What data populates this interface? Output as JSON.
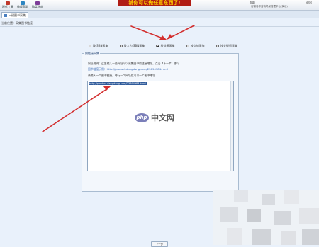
{
  "toolbar": {
    "buttons": [
      {
        "label": "建代工具",
        "color": "#c0392b"
      },
      {
        "label": "教程帮助",
        "color": "#2e86c1"
      },
      {
        "label": "购买指南",
        "color": "#7d3c98"
      }
    ],
    "help_links": [
      "帮助",
      "退出"
    ]
  },
  "banner": {
    "text": "铺你可以做任意东西了!"
  },
  "store_text": "店铺名称营销场景管理平台(演示)",
  "tab": {
    "label": "一键图书采集"
  },
  "location": "当前位置：采集图书链接",
  "radio_options": [
    {
      "label": "按ISBN采集",
      "selected": false
    },
    {
      "label": "按入为ISBN采集",
      "selected": false
    },
    {
      "label": "按链接采集",
      "selected": true
    },
    {
      "label": "按店铺采集",
      "selected": false
    },
    {
      "label": "按关键词采集",
      "selected": false
    }
  ],
  "panel": {
    "legend": "按链接采集",
    "instruction": "网址说明：这里输入一些网址可以采集图书的链接地址，点击【下一步】即可",
    "example_prefix": "图书链接示例：",
    "example_url": "http://product.dangdang.com/23694984.html",
    "note": "请输入一个图书链接，每行一个网址仅可以一个图书地址"
  },
  "textarea": {
    "value": "http://product.dangdang.com/23694984.html"
  },
  "watermark": {
    "badge": "php",
    "text": "中文网"
  },
  "bottom_button": "下一步",
  "colors": {
    "accent": "#d32f2f",
    "panel_border": "#a9bcd1",
    "selection": "#315c9b"
  }
}
